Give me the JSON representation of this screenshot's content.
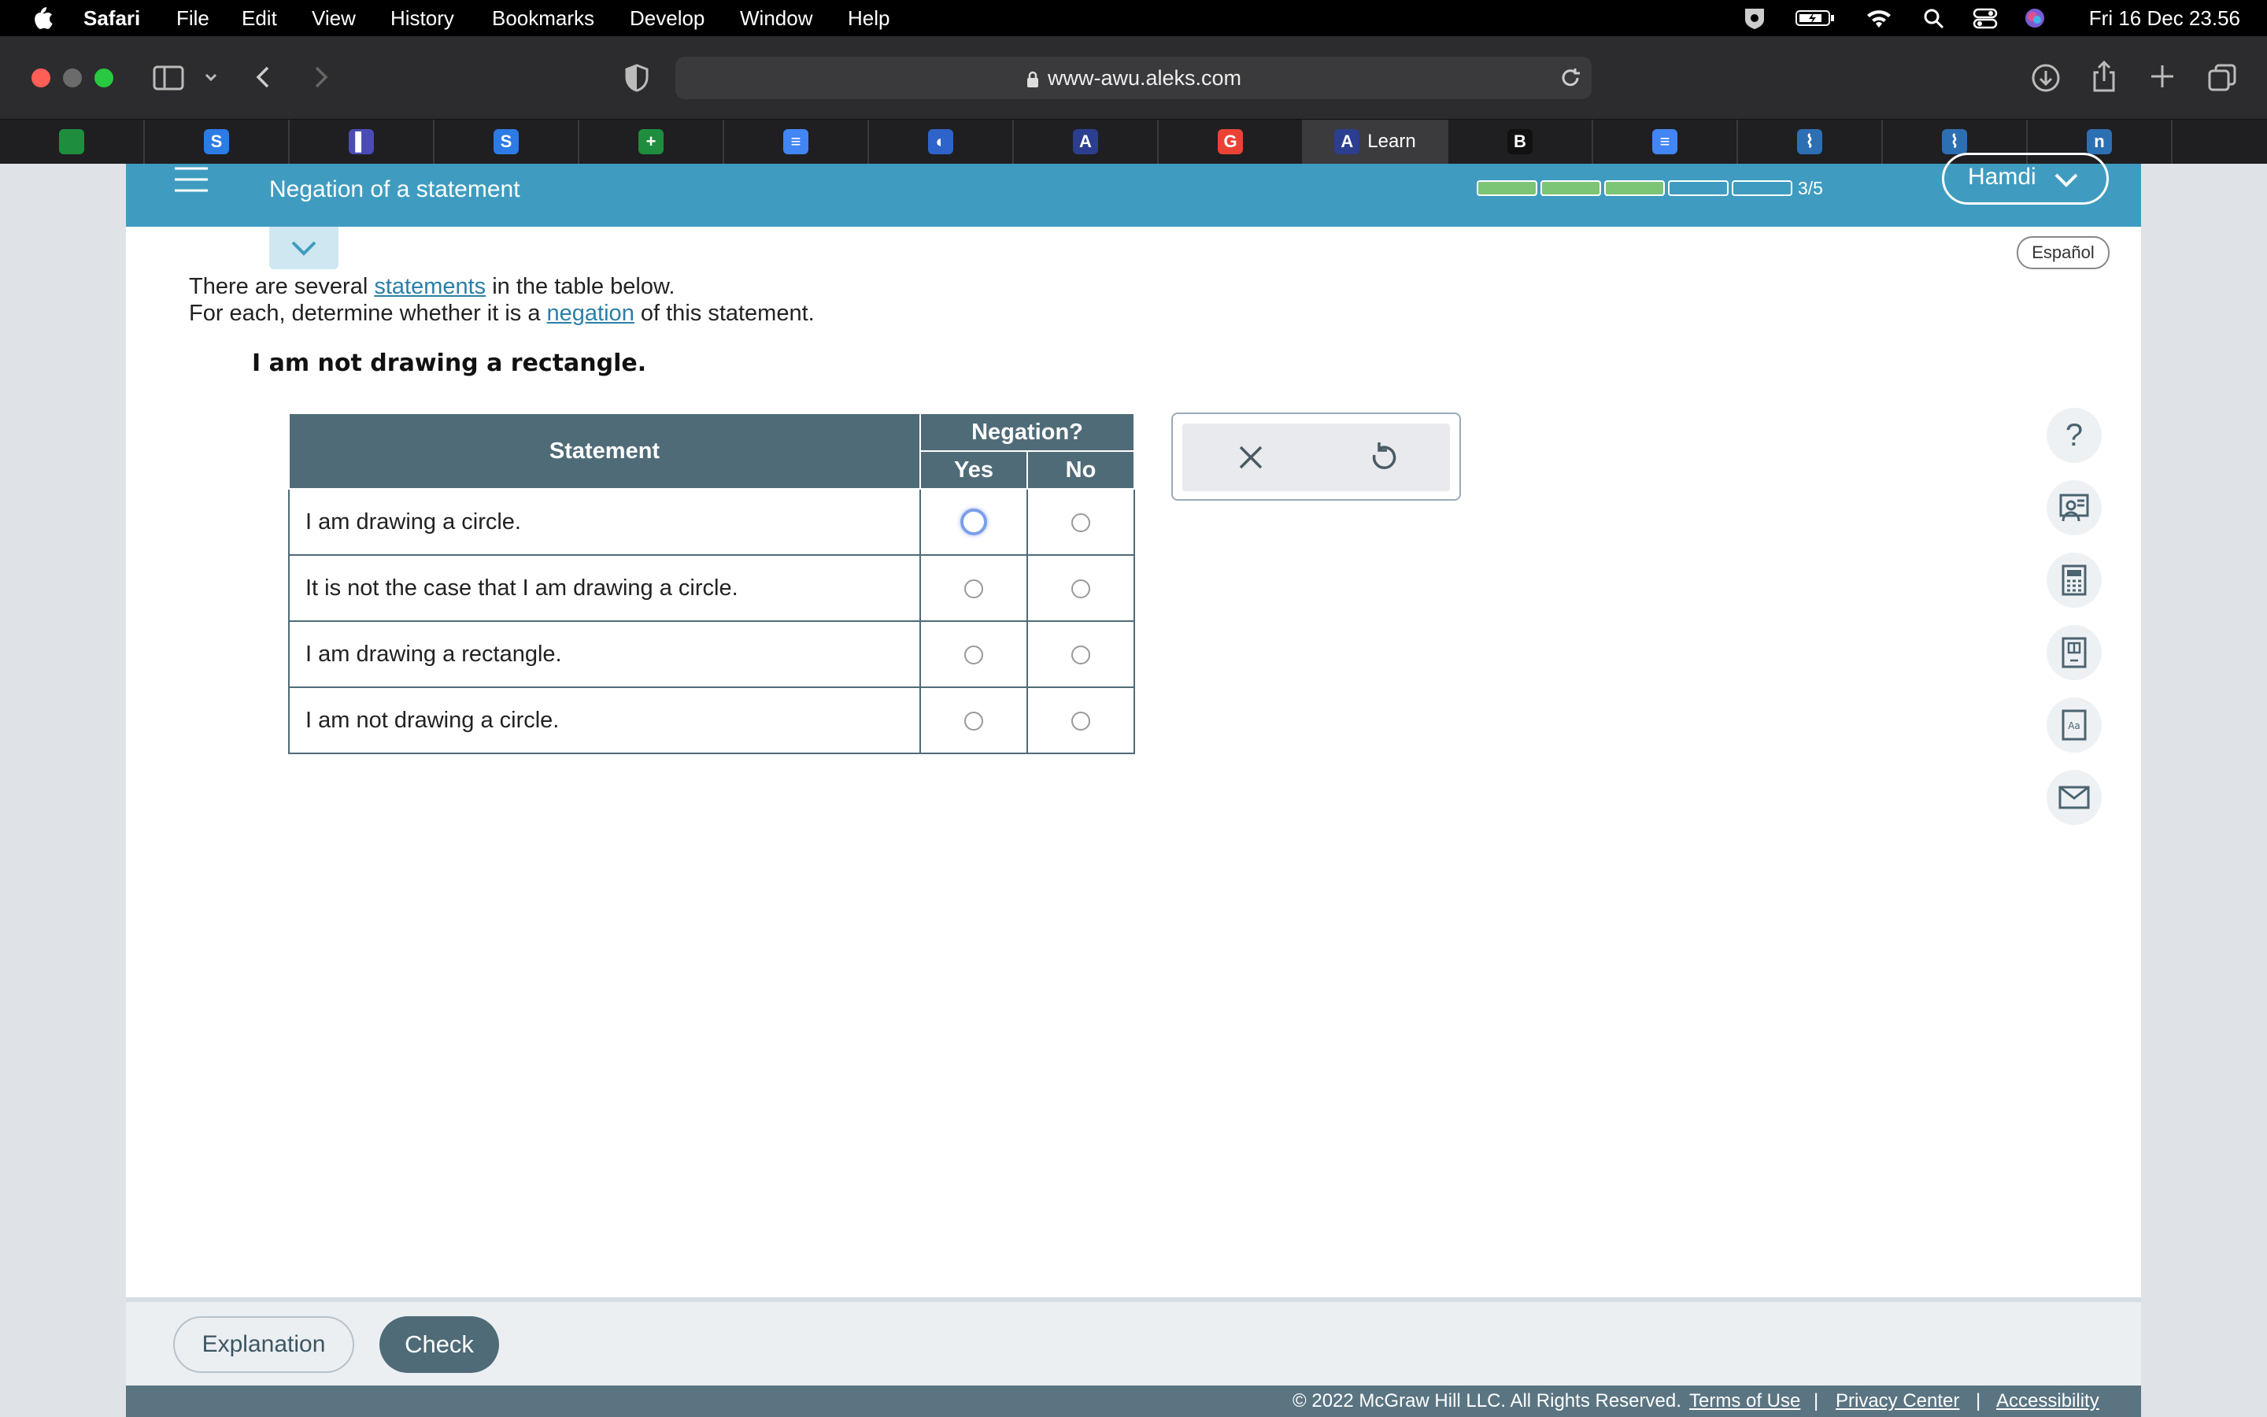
{
  "menubar": {
    "app": "Safari",
    "items": [
      "File",
      "Edit",
      "View",
      "History",
      "Bookmarks",
      "Develop",
      "Window",
      "Help"
    ],
    "datetime": "Fri 16 Dec  23.56"
  },
  "browser": {
    "url": "www-awu.aleks.com",
    "tabs": [
      {
        "icon": "google-drive-icon",
        "color": "#1e8e3e"
      },
      {
        "icon": "s-logo-icon",
        "color": "#2d7be5",
        "glyph": "S"
      },
      {
        "icon": "book-icon",
        "color": "#4b4bb5",
        "glyph": "▌"
      },
      {
        "icon": "s-logo-icon",
        "color": "#2d7be5",
        "glyph": "S"
      },
      {
        "icon": "sheets-icon",
        "color": "#1e8e3e",
        "glyph": "+"
      },
      {
        "icon": "docs-icon",
        "color": "#4285f4",
        "glyph": "≡"
      },
      {
        "icon": "pbs-icon",
        "color": "#2e63c9",
        "glyph": "◐"
      },
      {
        "icon": "aleks-icon",
        "color": "#2c3e90",
        "glyph": "A"
      },
      {
        "icon": "google-icon",
        "color": "#ea4335",
        "glyph": "G"
      },
      {
        "icon": "aleks-icon",
        "color": "#2c3e90",
        "glyph": "A",
        "label": "Learn",
        "active": true
      },
      {
        "icon": "b-icon",
        "color": "#111",
        "glyph": "B"
      },
      {
        "icon": "docs-icon",
        "color": "#4285f4",
        "glyph": "≡"
      },
      {
        "icon": "chart-icon",
        "color": "#2d6fb3",
        "glyph": "⌇"
      },
      {
        "icon": "chart-icon",
        "color": "#2d6fb3",
        "glyph": "⌇"
      },
      {
        "icon": "n-icon",
        "color": "#2d6fb3",
        "glyph": "n"
      }
    ]
  },
  "header": {
    "topic": "Negation of a statement",
    "progress_completed": 3,
    "progress_total": 5,
    "progress_label": "3/5",
    "user": "Hamdi"
  },
  "language_button": "Español",
  "question": {
    "line1_pre": "There are several ",
    "line1_link": "statements",
    "line1_post": " in the table below.",
    "line2_pre": "For each, determine whether it is a ",
    "line2_link": "negation",
    "line2_post": " of this statement.",
    "statement": "I am not drawing a rectangle.",
    "table": {
      "col_statement": "Statement",
      "col_group": "Negation?",
      "col_yes": "Yes",
      "col_no": "No",
      "rows": [
        "I am drawing a circle.",
        "It is not the case that I am drawing a circle.",
        "I am drawing a rectangle.",
        "I am not drawing a circle."
      ]
    }
  },
  "answer_tools": {
    "clear_icon": "close-icon",
    "undo_icon": "undo-icon"
  },
  "side_tools": [
    "help-icon",
    "tutor-icon",
    "calculator-icon",
    "textbook-icon",
    "dictionary-icon",
    "mail-icon"
  ],
  "footer": {
    "explanation": "Explanation",
    "check": "Check",
    "copyright": "© 2022 McGraw Hill LLC. All Rights Reserved.",
    "terms": "Terms of Use",
    "privacy": "Privacy Center",
    "accessibility": "Accessibility"
  },
  "colors": {
    "header": "#3f9cc0",
    "table_head": "#4f6b77",
    "link": "#2b7fa6",
    "progress_done": "#7cc576"
  }
}
